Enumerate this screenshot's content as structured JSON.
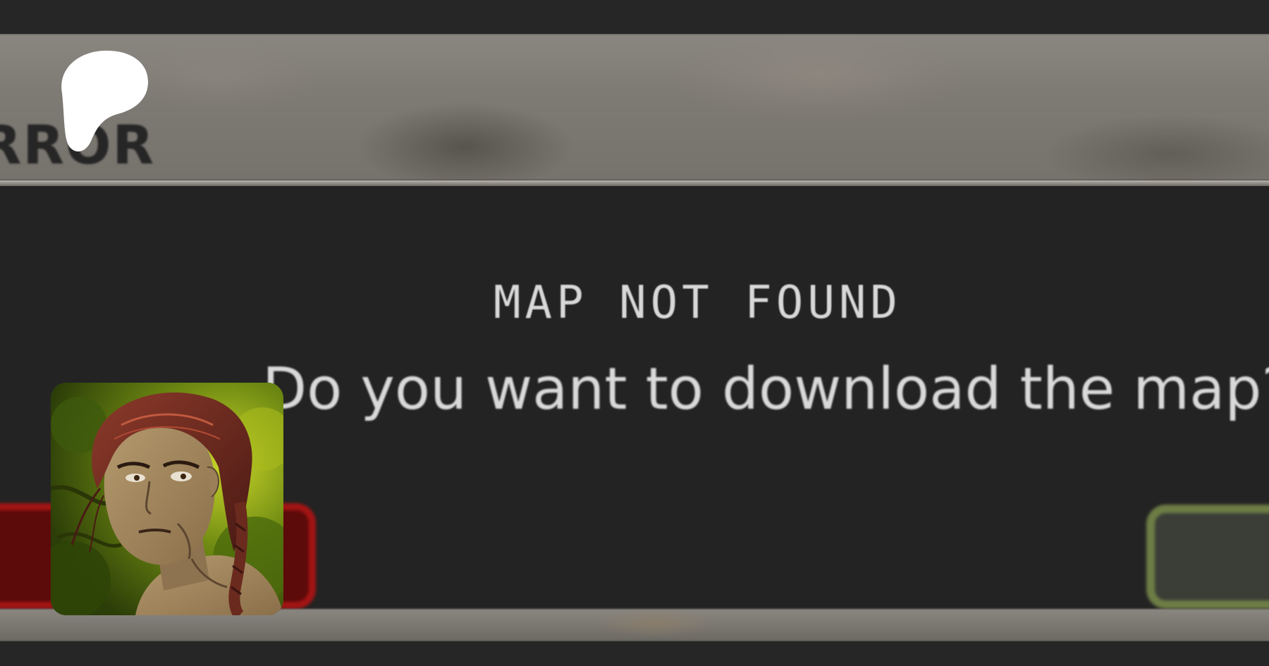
{
  "dialog": {
    "title": "ERROR",
    "heading": "MAP NOT FOUND",
    "message": "Do you want to download the map?",
    "cancel_button_color": "#a31414",
    "confirm_button_color": "#6d7d45"
  },
  "overlay": {
    "logo_icon": "patreon-logo-icon",
    "avatar_icon": "creator-avatar"
  },
  "colors": {
    "background": "#262626",
    "dialog_body": "#232323",
    "header_texture": "#7e7a74",
    "text": "#d9d9d9"
  }
}
